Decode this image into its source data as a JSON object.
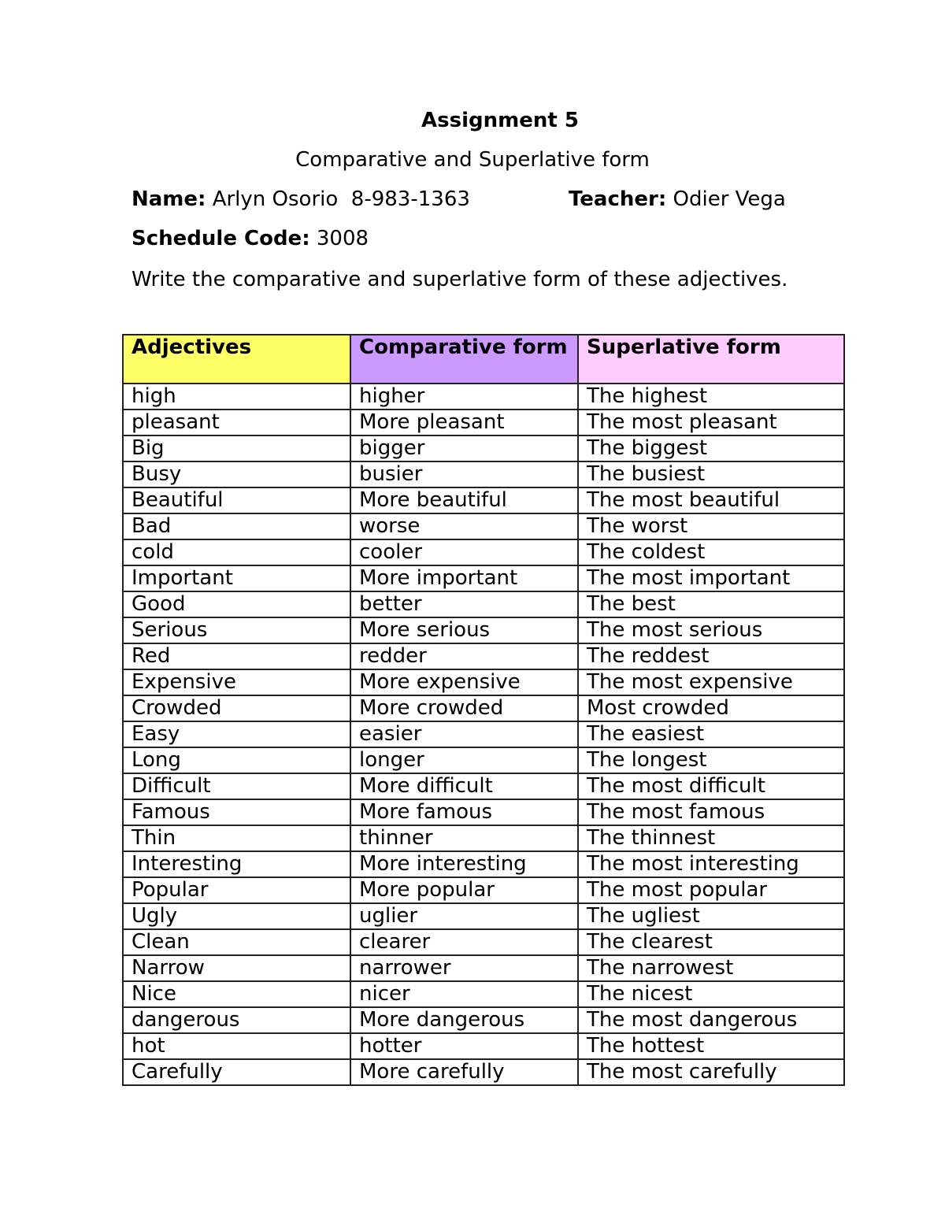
{
  "document": {
    "title": "Assignment 5",
    "subtitle": "Comparative and Superlative form",
    "name_label": "Name:",
    "name_value": "Arlyn Osorio  8-983-1363",
    "teacher_label": "Teacher:",
    "teacher_value": "Odier Vega",
    "schedule_label": "Schedule Code:",
    "schedule_value": "3008",
    "instructions": "Write the comparative and superlative form of these adjectives."
  },
  "table": {
    "headers": [
      {
        "label": "Adjectives",
        "color": "#ffff66"
      },
      {
        "label": "Comparative form",
        "color": "#cc99ff"
      },
      {
        "label": "Superlative form",
        "color": "#ffccff"
      }
    ],
    "rows": [
      [
        "high",
        "higher",
        "The highest"
      ],
      [
        "pleasant",
        "More pleasant",
        "The most pleasant"
      ],
      [
        "Big",
        "bigger",
        "The biggest"
      ],
      [
        "Busy",
        "busier",
        "The busiest"
      ],
      [
        "Beautiful",
        "More beautiful",
        "The most beautiful"
      ],
      [
        "Bad",
        "worse",
        "The worst"
      ],
      [
        "cold",
        "cooler",
        "The coldest"
      ],
      [
        "Important",
        "More important",
        "The most important"
      ],
      [
        "Good",
        "better",
        "The best"
      ],
      [
        "Serious",
        "More serious",
        "The most serious"
      ],
      [
        "Red",
        "redder",
        "The reddest"
      ],
      [
        "Expensive",
        "More expensive",
        "The most expensive"
      ],
      [
        "Crowded",
        "More crowded",
        "Most crowded"
      ],
      [
        "Easy",
        "easier",
        "The easiest"
      ],
      [
        "Long",
        "longer",
        "The longest"
      ],
      [
        "Difficult",
        "More difficult",
        "The most difficult"
      ],
      [
        "Famous",
        "More famous",
        "The most famous"
      ],
      [
        "Thin",
        "thinner",
        "The thinnest"
      ],
      [
        "Interesting",
        "More interesting",
        "The most interesting"
      ],
      [
        "Popular",
        "More popular",
        "The most popular"
      ],
      [
        "Ugly",
        "uglier",
        "The ugliest"
      ],
      [
        "Clean",
        "clearer",
        "The clearest"
      ],
      [
        "Narrow",
        "narrower",
        "The narrowest"
      ],
      [
        "Nice",
        "nicer",
        "The nicest"
      ],
      [
        "dangerous",
        "More dangerous",
        "The most dangerous"
      ],
      [
        "hot",
        "hotter",
        "The hottest"
      ],
      [
        "Carefully",
        "More carefully",
        "The most carefully"
      ]
    ]
  }
}
